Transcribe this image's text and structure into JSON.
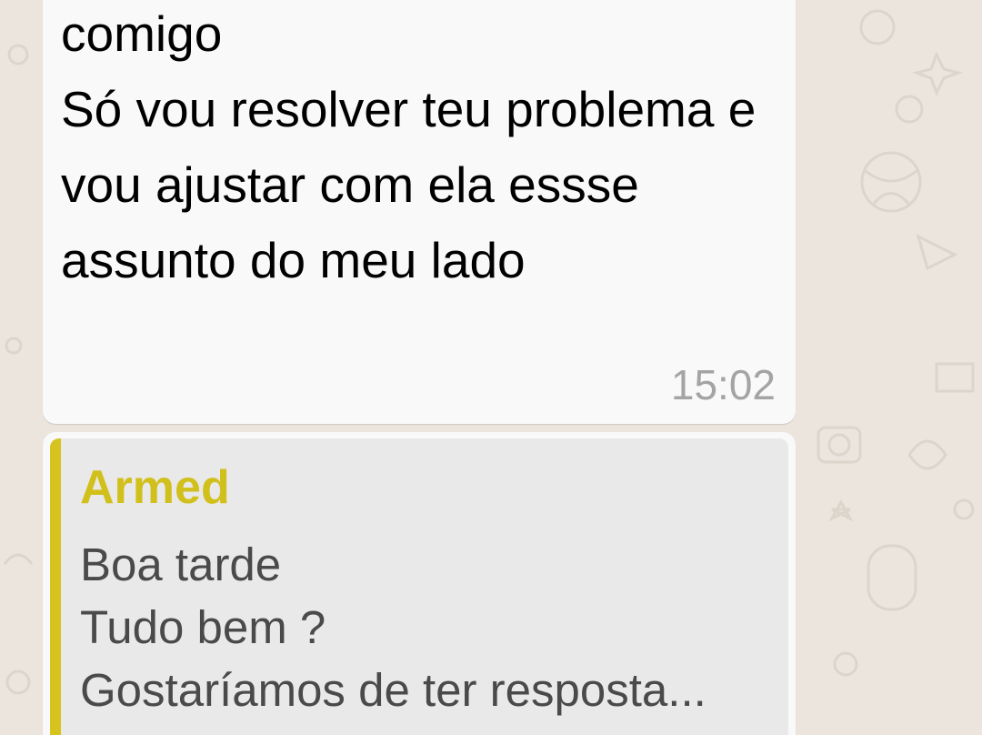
{
  "chat": {
    "wallpaper_color": "#ece5dd",
    "message": {
      "text": "comigo\nSó vou resolver teu problema e vou ajustar com ela essse assunto do meu lado",
      "time": "15:02"
    },
    "reply": {
      "quoted_author": "Armed",
      "quoted_author_color": "#d1c01c",
      "quoted_text": "Boa tarde\nTudo bem ?\nGostaríamos de ter resposta..."
    }
  }
}
